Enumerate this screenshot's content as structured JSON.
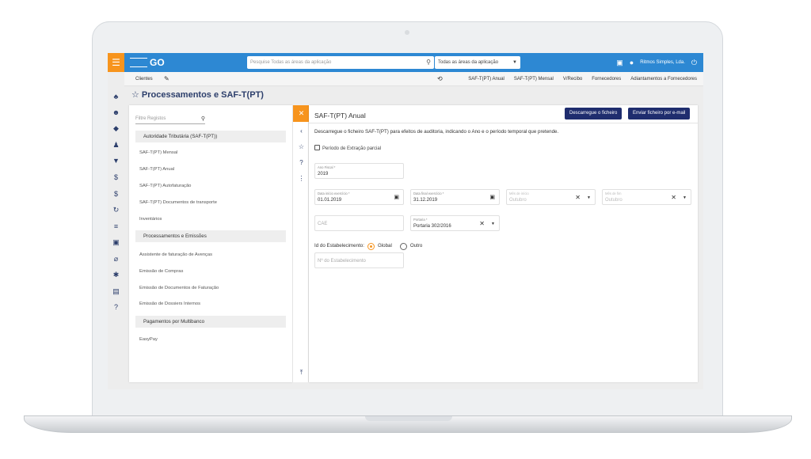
{
  "topbar": {
    "logo_text": "GO",
    "search_placeholder": "Pesquise Todas as áreas da aplicação",
    "scope_value": "Todas as áreas da aplicação",
    "company": "Ritmos Simples, Lda.",
    "accent_color": "#2d88d3",
    "menu_color": "#f7941d"
  },
  "subheader": {
    "clientes": "Clientes",
    "links": [
      "SAF-T(PT) Anual",
      "SAF-T(PT) Mensal",
      "V/Recibo",
      "Fornecedores",
      "Adiantamentos a Fornecedores"
    ]
  },
  "page": {
    "title": "Processamentos e SAF-T(PT)"
  },
  "left_panel": {
    "filter_placeholder": "Filtre Registos",
    "groups": [
      {
        "label": "Autoridade Tributária (SAF-T(PT))",
        "items": [
          "SAF-T(PT) Mensal",
          "SAF-T(PT) Anual",
          "SAF-T(PT) Autofaturação",
          "SAF-T(PT) Documentos de transporte",
          "Inventários"
        ]
      },
      {
        "label": "Processamentos e Emissões",
        "items": [
          "Assistente de faturação de Avenças",
          "Emissão de Compras",
          "Emissão de Documentos de Faturação",
          "Emissão de Dossiers Internos"
        ]
      },
      {
        "label": "Pagamentos por Multibanco",
        "items": [
          "EasyPay"
        ]
      }
    ]
  },
  "form": {
    "title": "SAF-T(PT) Anual",
    "download_label": "Descarregue o ficheiro",
    "email_label": "Enviar ficheiro por e-mail",
    "description": "Descarregue o ficheiro SAF-T(PT) para efeitos de auditoria, indicando o Ano e o período temporal que pretende.",
    "partial_label": "Período de Extração parcial",
    "ano_fiscal_label": "Ano Fiscal *",
    "ano_fiscal_value": "2019",
    "data_inicio_label": "Data início exercício *",
    "data_inicio_value": "01.01.2019",
    "data_fim_label": "Data final exercício *",
    "data_fim_value": "31.12.2019",
    "mes_inicio_label": "Mês de início",
    "mes_inicio_value": "Outubro",
    "mes_fim_label": "Mês de fim",
    "mes_fim_value": "Outubro",
    "cae_placeholder": "CAE",
    "portaria_label": "Portaria *",
    "portaria_value": "Portaria 302/2016",
    "estab_label": "Id do Estabelecimento:",
    "radio_global": "Global",
    "radio_outro": "Outro",
    "estab_placeholder": "Nº do Estabelecimento",
    "button_color": "#1f2d6e"
  }
}
